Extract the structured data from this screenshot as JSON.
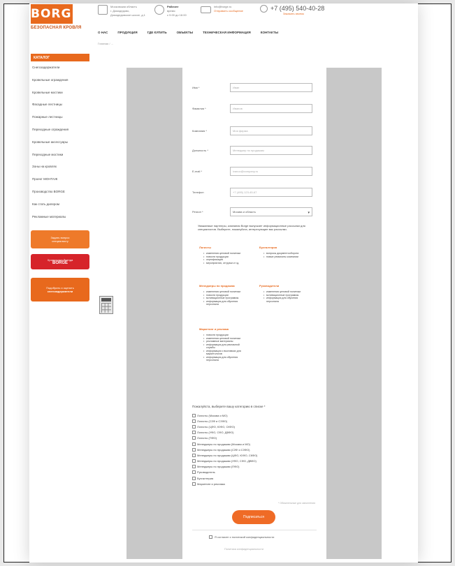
{
  "header": {
    "logo_text": "BORGE",
    "logo_subtitle": "БЕЗОПАСНАЯ КРОВЛЯ",
    "address_lines": [
      "Московская область",
      "г. Домодедово,",
      "Домодедовское шоссе, д.1"
    ],
    "hours_lines": [
      "Рабочее",
      "время",
      "с 9.00 до 18.00"
    ],
    "email": "info@borge.ru",
    "email_link": "Отправить сообщение",
    "phone": "+7 (495) 540-40-28",
    "callback": "Заказать звонок"
  },
  "nav": [
    "О НАС",
    "ПРОДУКЦИЯ",
    "ГДЕ КУПИТЬ",
    "ОБЪЕКТЫ",
    "ТЕХНИЧЕСКАЯ ИНФОРМАЦИЯ",
    "КОНТАКТЫ"
  ],
  "breadcrumb": "Главная / ...",
  "sidebar": {
    "title": "КАТАЛОГ",
    "items": [
      "Снегозадержатели",
      "Кровельные ограждения",
      "Кровельные мостики",
      "Фасадные лестницы",
      "Пожарные лестницы",
      "Переходные ограждения",
      "Кровельные аксессуары",
      "Переходные мостики",
      "Зоны на кровлях",
      "Проект МОНТАЖ",
      "Производство BORGE",
      "Как стать дилером",
      "Рекламные материалы"
    ],
    "promo1": [
      "Задать вопрос",
      "специалисту"
    ],
    "promo2_line": "Хронология бренда",
    "promo2_brand": "BORGE",
    "promo3": [
      "Подобрать и оценить",
      "снегозадержатели"
    ]
  },
  "form": {
    "fields": [
      {
        "label": "Имя *",
        "placeholder": "Иван"
      },
      {
        "label": "Фамилия *",
        "placeholder": "Иванов"
      },
      {
        "label": "Компания *",
        "placeholder": "Моя фирма"
      },
      {
        "label": "Должность *",
        "placeholder": "Менеджер по продажам"
      },
      {
        "label": "E-mail *",
        "placeholder": "ivanov@company.ru"
      },
      {
        "label": "Телефон",
        "placeholder": "+7 (495) 123-45-67"
      }
    ],
    "region_label": "Регион *",
    "region_value": "Москва и область",
    "note": "Уважаемые партнеры, компания Borge выпускает информационные рассылки для специалистов. Выберите, пожалуйста, интересующие вас рассылки.",
    "note_brand": "Borge",
    "groups": [
      {
        "title": "Логисты",
        "items": [
          "изменения ценовой политики",
          "новости продукции",
          "сертификация",
          "мероприятия, отгрузки и т.д."
        ]
      },
      {
        "title": "Бухгалтерия",
        "items": [
          "вопросы документооборота",
          "новые реквизиты компании"
        ]
      },
      {
        "title": "Менеджеры по продажам",
        "items": [
          "изменения ценовой политики",
          "новости продукции",
          "мотивационные программы",
          "информация для обучения персонала"
        ]
      },
      {
        "title": "Руководители",
        "items": [
          "изменения ценовой политики",
          "мотивационные программы",
          "информация для обучения персонала"
        ]
      },
      {
        "title": "Маркетинг и реклама",
        "items": [
          "новости продукции",
          "изменения ценовой политики",
          "рекламные материалы",
          "информация для рекламной службы",
          "информация о выставках для маркетологов",
          "информация для обучения персонала"
        ]
      }
    ],
    "question": "Пожалуйста, выберите вашу категорию в списке *",
    "checkboxes": [
      "Логисты (Москва и МО)",
      "Логисты (СЗФ и СЗФО)",
      "Логисты (ЦФО, ЮФО, СКФО)",
      "Логисты (УФО, СФО, ДВФО)",
      "Логисты (ПФО)",
      "Менеджеры по продажам (Москва и МО)",
      "Менеджеры по продажам (СЗФ и СЗФО)",
      "Менеджеры по продажам (ЦФО, ЮФО, СКФО)",
      "Менеджеры по продажам (УФО, СФО, ДВФО)",
      "Менеджеры по продажам (ПФО)",
      "Руководитель",
      "Бухгалтерия",
      "Маркетинг и реклама"
    ],
    "required_note": "* Обязательные для заполнения",
    "submit": "Подписаться",
    "agree": "Я согласен с политикой конфиденциальности",
    "policy": "Политика конфиденциальности"
  }
}
